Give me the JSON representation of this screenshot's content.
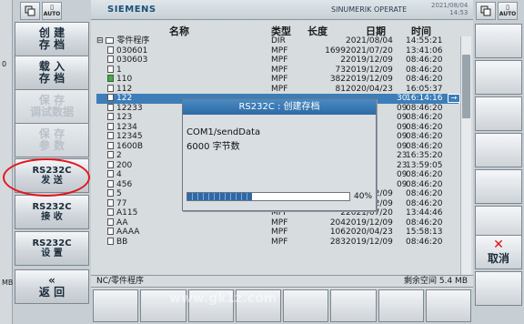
{
  "outer_left": {
    "frag1": "0",
    "frag2": "MB"
  },
  "top_icons": {
    "auto_label": "AUTO"
  },
  "left_softkeys": [
    {
      "label": "创 建\n存 档",
      "disabled": false
    },
    {
      "label": "载 入\n存 档",
      "disabled": false
    },
    {
      "label": "保 存\n调试数据",
      "disabled": true
    },
    {
      "label": "保 存\n参 数",
      "disabled": true
    },
    {
      "label": "RS232C\n发 送",
      "disabled": false
    },
    {
      "label": "RS232C\n接 收",
      "disabled": false
    },
    {
      "label": "RS232C\n设 置",
      "disabled": false
    },
    {
      "label": "«\n返 回",
      "disabled": false
    }
  ],
  "header": {
    "brand": "SIEMENS",
    "product": "SINUMERIK OPERATE",
    "date": "2021/08/04",
    "time": "14:53"
  },
  "columns": {
    "name": "名称",
    "type": "类型",
    "length": "长度",
    "date": "日期",
    "time": "时间"
  },
  "rows": [
    {
      "name": "零件程序",
      "type": "DIR",
      "length": "",
      "date": "2021/08/04",
      "time": "14:55:21",
      "dir": true
    },
    {
      "name": "030601",
      "type": "MPF",
      "length": "1699",
      "date": "2021/07/20",
      "time": "13:41:06"
    },
    {
      "name": "030603",
      "type": "MPF",
      "length": "2",
      "date": "2019/12/09",
      "time": "08:46:20"
    },
    {
      "name": "1",
      "type": "MPF",
      "length": "73",
      "date": "2019/12/09",
      "time": "08:46:20"
    },
    {
      "name": "110",
      "type": "MPF",
      "length": "382",
      "date": "2019/12/09",
      "time": "08:46:20",
      "green": true
    },
    {
      "name": "112",
      "type": "MPF",
      "length": "81",
      "date": "2020/04/23",
      "time": "16:05:37"
    },
    {
      "name": "122",
      "type": "",
      "length": "",
      "date": "30",
      "time": "16:14:16",
      "selected": true
    },
    {
      "name": "12233",
      "type": "",
      "length": "",
      "date": "09",
      "time": "08:46:20"
    },
    {
      "name": "123",
      "type": "",
      "length": "",
      "date": "09",
      "time": "08:46:20"
    },
    {
      "name": "1234",
      "type": "",
      "length": "",
      "date": "09",
      "time": "08:46:20"
    },
    {
      "name": "12345",
      "type": "",
      "length": "",
      "date": "09",
      "time": "08:46:20"
    },
    {
      "name": "1600B",
      "type": "",
      "length": "",
      "date": "09",
      "time": "08:46:20"
    },
    {
      "name": "2",
      "type": "",
      "length": "",
      "date": "23",
      "time": "16:35:20"
    },
    {
      "name": "200",
      "type": "",
      "length": "",
      "date": "23",
      "time": "13:59:05"
    },
    {
      "name": "4",
      "type": "",
      "length": "",
      "date": "09",
      "time": "08:46:20"
    },
    {
      "name": "456",
      "type": "",
      "length": "",
      "date": "09",
      "time": "08:46:20"
    },
    {
      "name": "5",
      "type": "MPF",
      "length": "284",
      "date": "2019/12/09",
      "time": "08:46:20"
    },
    {
      "name": "77",
      "type": "MPF",
      "length": "93",
      "date": "2019/12/09",
      "time": "08:46:20"
    },
    {
      "name": "A115",
      "type": "MPF",
      "length": "2",
      "date": "2021/07/20",
      "time": "13:44:46"
    },
    {
      "name": "AA",
      "type": "MPF",
      "length": "204",
      "date": "2019/12/09",
      "time": "08:46:20"
    },
    {
      "name": "AAAA",
      "type": "MPF",
      "length": "106",
      "date": "2020/04/23",
      "time": "15:58:13"
    },
    {
      "name": "BB",
      "type": "MPF",
      "length": "283",
      "date": "2019/12/09",
      "time": "08:46:20"
    }
  ],
  "statusbar": {
    "path": "NC/零件程序",
    "free": "剩余空间 5.4 MB"
  },
  "dialog": {
    "title": "RS232C : 创建存档",
    "line1": "COM1/sendData",
    "line2": "6000 字节数",
    "progress_pct": 40,
    "progress_label": "40%"
  },
  "right": {
    "cancel_label": "取消"
  },
  "watermark": "www.gk1z.com"
}
